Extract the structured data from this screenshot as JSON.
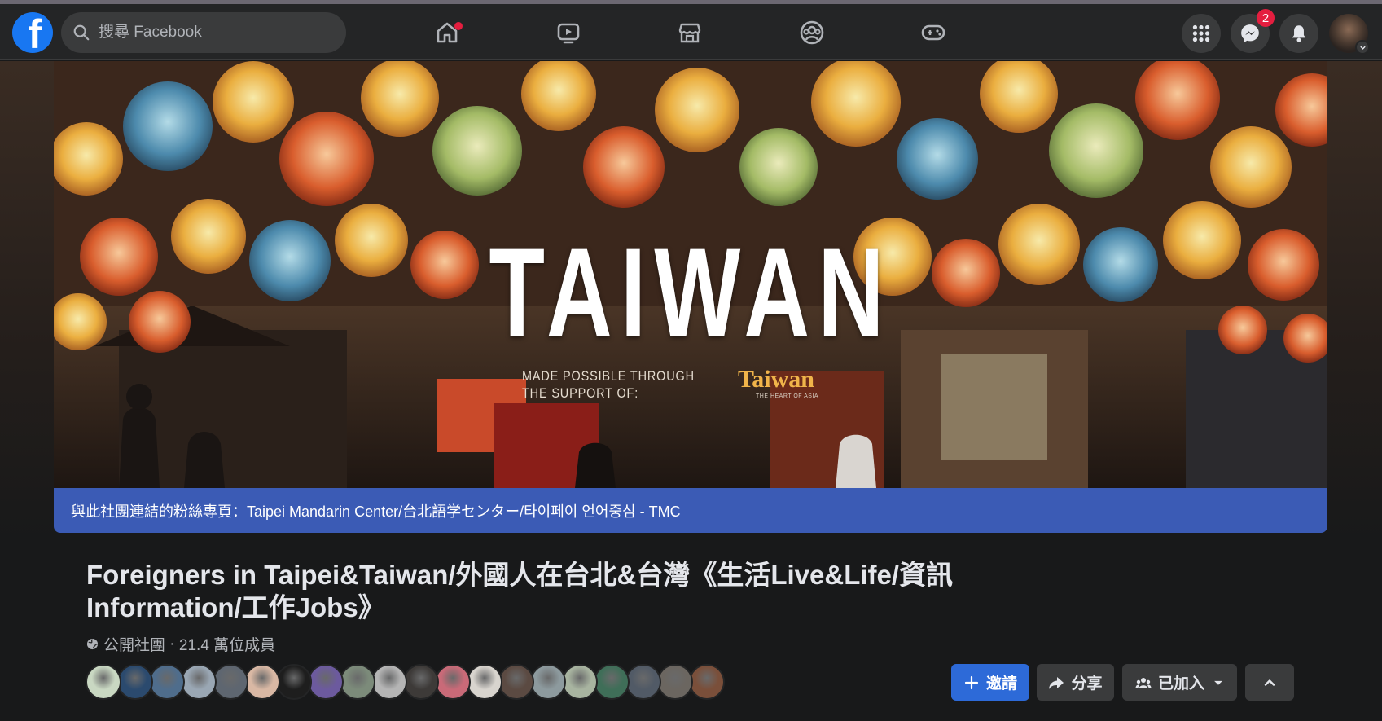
{
  "search": {
    "placeholder": "搜尋 Facebook"
  },
  "nav": {
    "tabs": [
      "home-icon",
      "watch-icon",
      "marketplace-icon",
      "groups-icon",
      "gaming-icon"
    ],
    "messenger_badge": "2"
  },
  "cover": {
    "title": "TAIWAN",
    "subtitle": "MADE POSSIBLE THROUGH\nTHE SUPPORT OF:",
    "brand": "Taiwan",
    "brand_sub": "THE HEART OF ASIA"
  },
  "linked_page": {
    "label": "與此社團連結的粉絲專頁：",
    "name": "Taipei Mandarin Center/台北語学センター/타이페이 언어중심 - TMC"
  },
  "group": {
    "title": "Foreigners in Taipei&Taiwan/外國人在台北&台灣《生活Live&Life/資訊Information/工作Jobs》",
    "privacy": "公開社團",
    "separator": " · ",
    "member_count": "21.4 萬位成員"
  },
  "member_avatars": [
    {
      "color": "#c9d8c2"
    },
    {
      "color": "#2b4a6e"
    },
    {
      "color": "#4f6d8c"
    },
    {
      "color": "#9aa7b4"
    },
    {
      "color": "#5e6670"
    },
    {
      "color": "#d9b8a4"
    },
    {
      "color": "#1e1e1e"
    },
    {
      "color": "#6c5a9e"
    },
    {
      "color": "#7c8b7a"
    },
    {
      "color": "#b5b5b5"
    },
    {
      "color": "#3d3a38"
    },
    {
      "color": "#c96a78"
    },
    {
      "color": "#d8d4ce"
    },
    {
      "color": "#5b4a42"
    },
    {
      "color": "#8d9a9e"
    },
    {
      "color": "#a8b4a0"
    },
    {
      "color": "#3f6e58"
    },
    {
      "color": "#515a66"
    },
    {
      "color": "#6b6660"
    },
    {
      "color": "#7a4f3a"
    }
  ],
  "actions": {
    "invite": "邀請",
    "share": "分享",
    "joined": "已加入"
  },
  "colors": {
    "accent": "#2d6ad8",
    "linked_bar": "#3b5bb5",
    "badge": "#e41e3f"
  }
}
